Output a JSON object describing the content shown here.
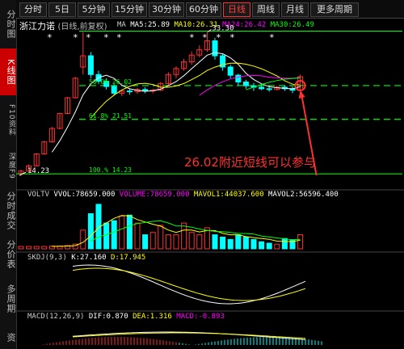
{
  "tabs": [
    "分时",
    "5日",
    "5分钟",
    "15分钟",
    "30分钟",
    "60分钟",
    "日线",
    "周线",
    "月线",
    "更多周期"
  ],
  "active_tab": "日线",
  "sidebar": [
    "分时图",
    "K线图",
    "F10资料",
    "深度F9",
    "分时成交",
    "分价表",
    "多周期",
    "资"
  ],
  "stock": {
    "name": "浙江力诺",
    "note": "(日线,前复权)"
  },
  "ma_legend": {
    "label": "MA",
    "ma5": "MA5:25.89",
    "ma10": "MA10:26.31",
    "ma24": "MA24:26.42",
    "ma30": "MA30:26.49"
  },
  "price_levels": {
    "high": "33.30",
    "low": "14.23",
    "fib50": "50.0% 26.02",
    "fib618": "61.8% 21.51",
    "fib100": "100.% 14.23"
  },
  "annotation": "26.02附近短线可以参与",
  "vol_legend": {
    "label": "VOLTV",
    "vvol": "VVOL:78659.000",
    "volume": "VOLUME:78659.000",
    "mavol1": "MAVOL1:44037.600",
    "mavol2": "MAVOL2:56596.400"
  },
  "skdj_legend": {
    "label": "SKDJ(9,3)",
    "k": "K:27.160",
    "d": "D:17.945"
  },
  "macd_legend": {
    "label": "MACD(12,26,9)",
    "dif": "DIF:0.870",
    "dea": "DEA:1.316",
    "macd": "MACD:-0.893"
  },
  "colors": {
    "up": "#ff3030",
    "down": "#00ffff",
    "ma5": "#ffffff",
    "ma10": "#ffff00",
    "ma24": "#ff00ff",
    "ma30": "#00ff00",
    "fib": "#00ff00",
    "annotation": "#ff3030"
  },
  "chart_data": [
    {
      "type": "candlestick",
      "title": "浙江力诺 (日线,前复权)",
      "candles_ohlc": [
        [
          14.3,
          14.8,
          14.0,
          14.6
        ],
        [
          14.6,
          15.5,
          14.5,
          15.3
        ],
        [
          15.3,
          17.0,
          15.2,
          16.9
        ],
        [
          16.9,
          18.6,
          16.8,
          18.5
        ],
        [
          18.5,
          20.5,
          18.4,
          20.3
        ],
        [
          20.3,
          22.4,
          20.2,
          22.3
        ],
        [
          22.3,
          24.5,
          22.2,
          24.4
        ],
        [
          24.4,
          27.2,
          24.3,
          27.0
        ],
        [
          28.5,
          33.2,
          27.5,
          30.0
        ],
        [
          30.0,
          30.5,
          27.0,
          27.5
        ],
        [
          27.5,
          28.0,
          26.2,
          26.6
        ],
        [
          26.6,
          27.0,
          25.5,
          25.9
        ],
        [
          25.9,
          26.2,
          24.7,
          25.0
        ],
        [
          25.0,
          25.5,
          24.6,
          25.3
        ],
        [
          25.3,
          25.6,
          24.8,
          25.2
        ],
        [
          25.2,
          25.7,
          24.9,
          25.5
        ],
        [
          25.5,
          25.8,
          25.0,
          25.3
        ],
        [
          25.3,
          25.6,
          25.0,
          25.4
        ],
        [
          25.4,
          26.5,
          25.3,
          26.3
        ],
        [
          26.3,
          27.8,
          26.0,
          27.5
        ],
        [
          27.5,
          28.6,
          27.0,
          28.3
        ],
        [
          28.3,
          29.6,
          28.0,
          29.2
        ],
        [
          29.2,
          30.6,
          28.8,
          30.1
        ],
        [
          30.1,
          31.4,
          29.8,
          30.8
        ],
        [
          30.8,
          33.3,
          30.5,
          32.0
        ],
        [
          32.0,
          32.4,
          29.5,
          30.0
        ],
        [
          30.0,
          30.3,
          28.0,
          28.5
        ],
        [
          28.5,
          28.8,
          27.0,
          27.4
        ],
        [
          27.4,
          27.6,
          26.0,
          26.5
        ],
        [
          26.5,
          26.8,
          25.6,
          26.0
        ],
        [
          26.0,
          26.4,
          25.3,
          25.8
        ],
        [
          25.8,
          26.2,
          25.4,
          25.6
        ],
        [
          25.6,
          26.0,
          25.2,
          25.5
        ],
        [
          25.5,
          26.0,
          25.4,
          25.8
        ],
        [
          25.8,
          26.1,
          25.3,
          25.6
        ],
        [
          25.6,
          25.9,
          25.0,
          25.4
        ],
        [
          25.4,
          27.5,
          25.3,
          27.2
        ]
      ],
      "fib_levels": [
        33.3,
        26.02,
        21.51,
        14.23
      ]
    },
    {
      "type": "bar",
      "title": "VOLTV",
      "volume_rel": [
        0.05,
        0.05,
        0.05,
        0.05,
        0.06,
        0.06,
        0.07,
        0.1,
        0.4,
        0.75,
        0.95,
        0.55,
        0.6,
        0.7,
        0.72,
        0.55,
        0.3,
        0.35,
        0.5,
        0.3,
        0.3,
        0.55,
        0.35,
        0.3,
        0.45,
        0.3,
        0.25,
        0.2,
        0.3,
        0.25,
        0.2,
        0.15,
        0.12,
        0.1,
        0.22,
        0.18,
        0.3
      ],
      "volume_up": [
        1,
        1,
        1,
        1,
        1,
        1,
        1,
        1,
        1,
        0,
        0,
        0,
        0,
        1,
        0,
        1,
        0,
        1,
        1,
        1,
        1,
        1,
        1,
        1,
        1,
        0,
        0,
        0,
        0,
        0,
        0,
        0,
        0,
        1,
        0,
        0,
        1
      ]
    }
  ]
}
